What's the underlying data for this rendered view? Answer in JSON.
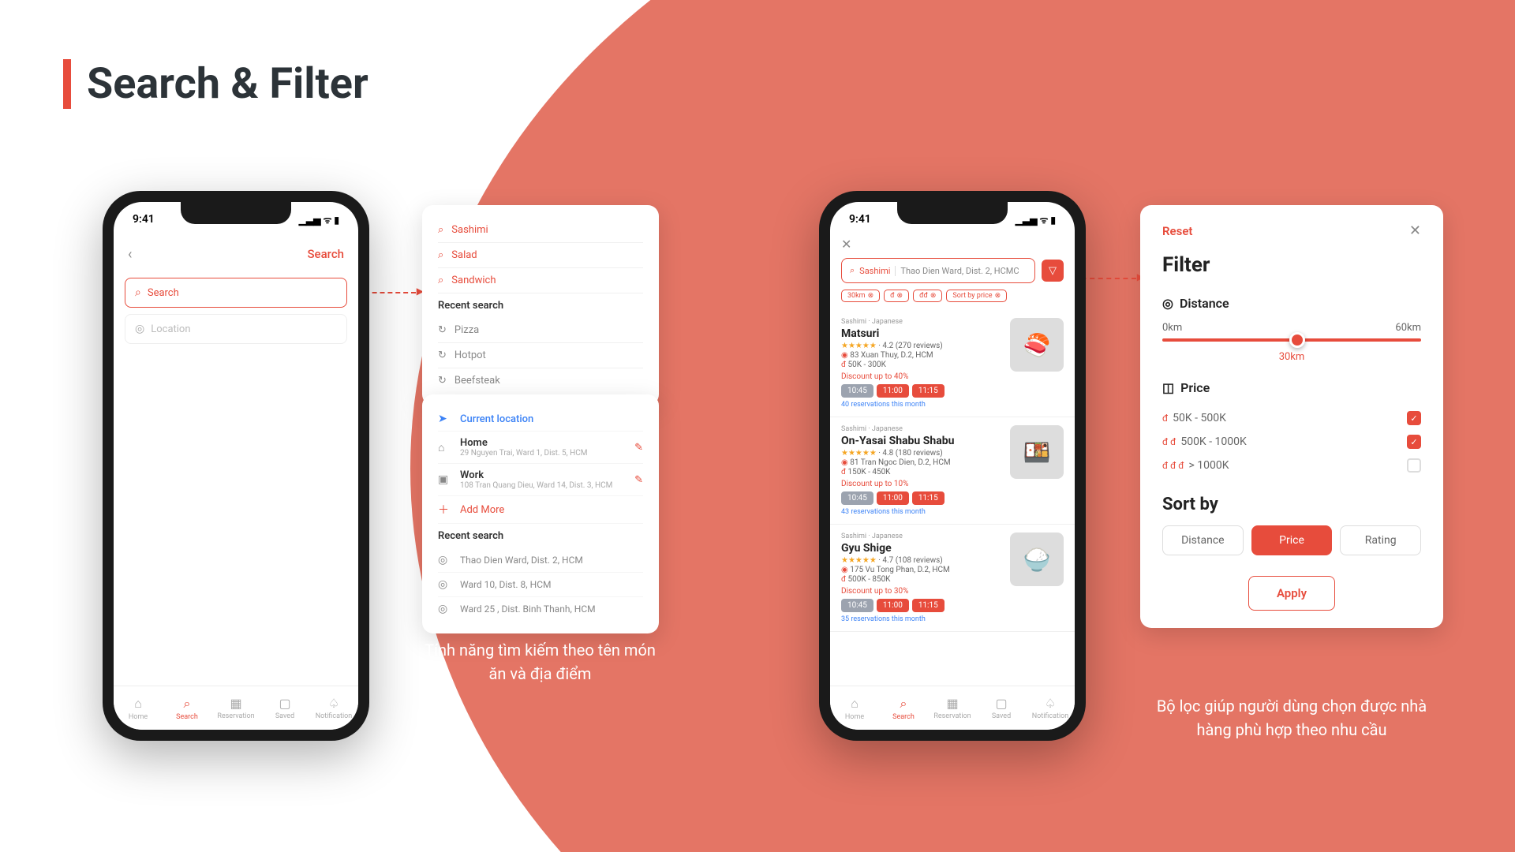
{
  "slide": {
    "title": "Search & Filter"
  },
  "captions": {
    "search": "Tính năng tìm kiếm theo tên món ăn và địa điểm",
    "filter": "Bộ lọc giúp người dùng chọn được nhà hàng phù hợp theo nhu cầu"
  },
  "status": {
    "time": "9:41"
  },
  "phone1": {
    "nav_action": "Search",
    "search_ph": "Search",
    "location_ph": "Location"
  },
  "search_suggestions": {
    "items": [
      "Sashimi",
      "Salad",
      "Sandwich"
    ],
    "recent_label": "Recent search",
    "recent": [
      "Pizza",
      "Hotpot",
      "Beefsteak"
    ]
  },
  "location_panel": {
    "current": "Current location",
    "saved": [
      {
        "name": "Home",
        "addr": "29 Nguyen Trai, Ward 1, Dist. 5, HCM"
      },
      {
        "name": "Work",
        "addr": "108 Tran Quang Dieu, Ward 14, Dist. 3, HCM"
      }
    ],
    "add_more": "Add More",
    "recent_label": "Recent search",
    "recent": [
      "Thao Dien Ward, Dist. 2, HCM",
      "Ward 10, Dist. 8, HCM",
      "Ward 25 , Dist. Binh Thanh, HCM"
    ]
  },
  "phone2": {
    "query": "Sashimi",
    "location": "Thao Dien Ward, Dist. 2, HCMC",
    "chips": [
      "30km",
      "đ",
      "đđ",
      "Sort by price"
    ]
  },
  "results": [
    {
      "cat": "Sashimi · Japanese",
      "name": "Matsuri",
      "rating": "4.2 (270 reviews)",
      "addr": "83 Xuan Thuy, D.2, HCM",
      "price": "50K - 300K",
      "discount": "Discount up to 40%",
      "slots": [
        "10:45",
        "11:00",
        "11:15"
      ],
      "res": "40 reservations this month",
      "emoji": "🍣"
    },
    {
      "cat": "Sashimi · Japanese",
      "name": "On-Yasai Shabu Shabu",
      "rating": "4.8 (180 reviews)",
      "addr": "81 Tran Ngoc Dien, D.2, HCM",
      "price": "150K - 450K",
      "discount": "Discount up to 10%",
      "slots": [
        "10:45",
        "11:00",
        "11:15"
      ],
      "res": "43 reservations this month",
      "emoji": "🍱"
    },
    {
      "cat": "Sashimi · Japanese",
      "name": "Gyu Shige",
      "rating": "4.7 (108 reviews)",
      "addr": "175 Vu Tong Phan, D.2, HCM",
      "price": "500K - 850K",
      "discount": "Discount up to 30%",
      "slots": [
        "10:45",
        "11:00",
        "11:15"
      ],
      "res": "35 reservations this month",
      "emoji": "🍚"
    }
  ],
  "nav": {
    "items": [
      "Home",
      "Search",
      "Reservation",
      "Saved",
      "Notification"
    ]
  },
  "filter": {
    "reset": "Reset",
    "title": "Filter",
    "distance": {
      "label": "Distance",
      "min": "0km",
      "max": "60km",
      "value": "30km"
    },
    "price": {
      "label": "Price",
      "opts": [
        {
          "sym": "đ",
          "range": "50K - 500K",
          "checked": true
        },
        {
          "sym": "đ đ",
          "range": "500K - 1000K",
          "checked": true
        },
        {
          "sym": "đ đ đ",
          "range": "> 1000K",
          "checked": false
        }
      ]
    },
    "sortby": {
      "label": "Sort by",
      "opts": [
        "Distance",
        "Price",
        "Rating"
      ],
      "active": 1
    },
    "apply": "Apply"
  }
}
